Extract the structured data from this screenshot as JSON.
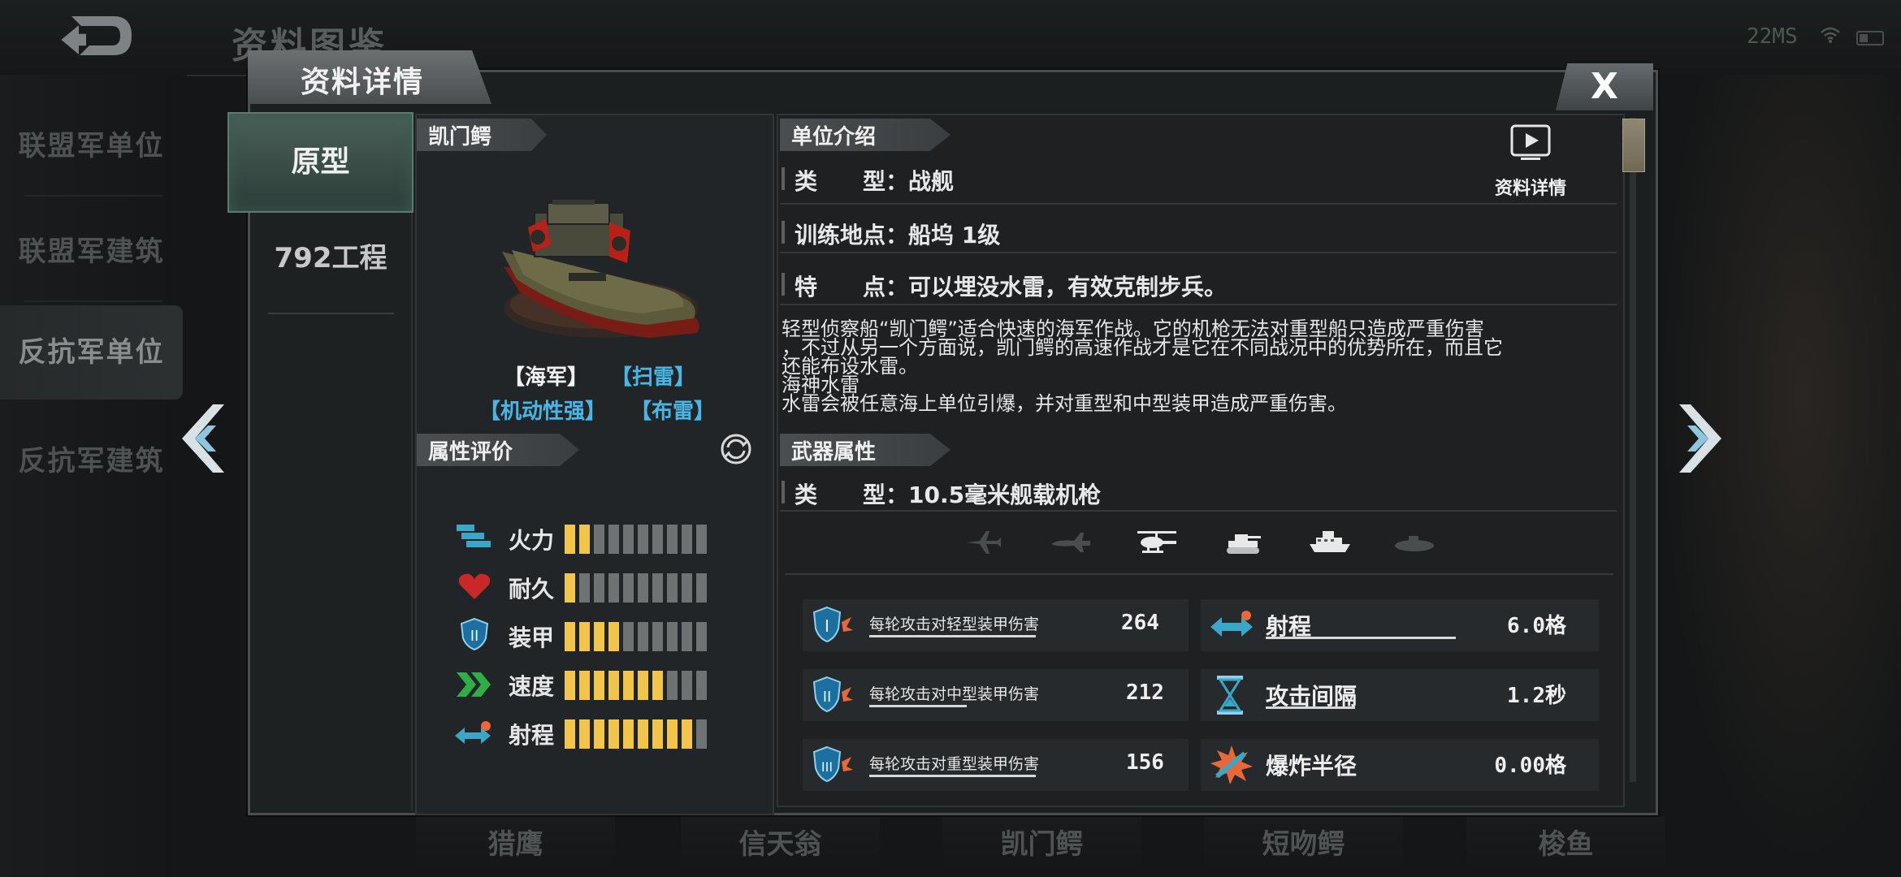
{
  "header": {
    "bg_title": "资料图鉴",
    "status_text": "22MS"
  },
  "sidebar": {
    "categories": [
      {
        "label": "联盟军单位"
      },
      {
        "label": "联盟军建筑"
      },
      {
        "label": "反抗军单位"
      },
      {
        "label": "反抗军建筑"
      }
    ]
  },
  "bottom_tabs": [
    "猎鹰",
    "信天翁",
    "凯门鳄",
    "短吻鳄",
    "梭鱼"
  ],
  "modal": {
    "tab_title": "资料详情",
    "close_label": "X",
    "variants": [
      {
        "label": "原型"
      },
      {
        "label": "792工程"
      }
    ]
  },
  "unit": {
    "name": "凯门鳄",
    "tags": [
      {
        "text": "【海军】",
        "color": "#f2f2f2"
      },
      {
        "text": "【扫雷】",
        "color": "#48b6e6"
      },
      {
        "text": "【机动性强】",
        "color": "#48b6e6"
      },
      {
        "text": "【布雷】",
        "color": "#48b6e6"
      }
    ],
    "attr_header": "属性评价",
    "attributes": [
      {
        "label": "火力",
        "icon": "firepower-icon",
        "level": 2,
        "max": 10
      },
      {
        "label": "耐久",
        "icon": "heart-icon",
        "level": 1,
        "max": 10
      },
      {
        "label": "装甲",
        "icon": "shield-icon",
        "level": 4,
        "max": 10
      },
      {
        "label": "速度",
        "icon": "speed-chevron-icon",
        "level": 7,
        "max": 10
      },
      {
        "label": "射程",
        "icon": "range-arrow-icon",
        "level": 9,
        "max": 10
      }
    ]
  },
  "info": {
    "intro_header": "单位介绍",
    "video_label": "资料详情",
    "type_key": "类　　型：",
    "type_value": "战舰",
    "train_key": "训练地点：",
    "train_value": "船坞 1级",
    "feature_key": "特　　点：",
    "feature_value": "可以埋没水雷，有效克制步兵。",
    "description_lines": [
      "轻型侦察船“凯门鳄”适合快速的海军作战。它的机枪无法对重型船只造成严重伤害",
      "，不过从另一个方面说，凯门鳄的高速作战才是它在不同战况中的优势所在，而且它",
      "还能布设水雷。"
    ],
    "mine_title": "海神水雷",
    "mine_desc": "水雷会被任意海上单位引爆，并对重型和中型装甲造成严重伤害。",
    "weapon_header": "武器属性",
    "weapon_type_key": "类　　型：",
    "weapon_type_value": "10.5毫米舰载机枪",
    "targets": [
      {
        "icon": "jet-icon",
        "active": false
      },
      {
        "icon": "plane-icon",
        "active": false
      },
      {
        "icon": "helicopter-icon",
        "active": true
      },
      {
        "icon": "tank-icon",
        "active": true
      },
      {
        "icon": "ship-icon",
        "active": true
      },
      {
        "icon": "submarine-icon",
        "active": false
      }
    ],
    "damage_stats": [
      {
        "label": "每轮攻击对轻型装甲伤害",
        "value": "264",
        "icon": "light-armor-icon"
      },
      {
        "label": "每轮攻击对中型装甲伤害",
        "value": "212",
        "icon": "medium-armor-icon"
      },
      {
        "label": "每轮攻击对重型装甲伤害",
        "value": "156",
        "icon": "heavy-armor-icon"
      }
    ],
    "other_stats": [
      {
        "label": "射程",
        "value": "6.0格",
        "icon": "range-icon"
      },
      {
        "label": "攻击间隔",
        "value": "1.2秒",
        "icon": "hourglass-icon"
      },
      {
        "label": "爆炸半径",
        "value": "0.00格",
        "icon": "explosion-icon"
      }
    ]
  }
}
